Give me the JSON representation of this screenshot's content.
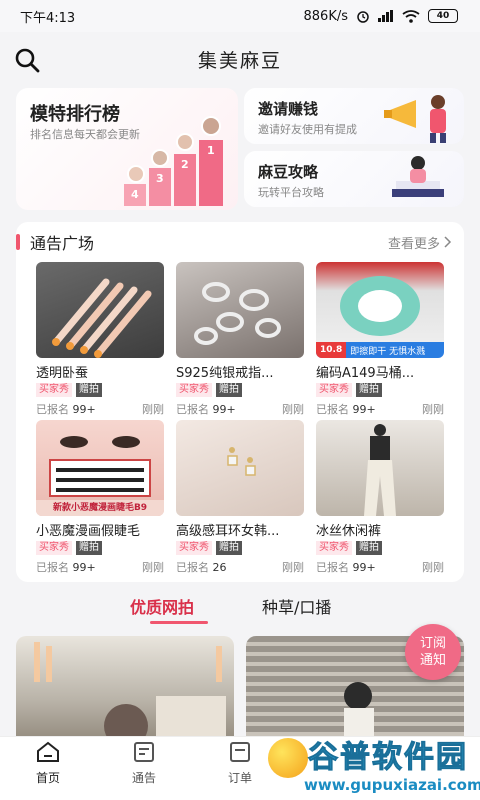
{
  "status": {
    "time": "下午4:13",
    "net_speed": "886K/s",
    "battery": "40"
  },
  "header": {
    "title": "集美麻豆"
  },
  "promo": {
    "ranking": {
      "title": "模特排行榜",
      "subtitle": "排名信息每天都会更新",
      "ranks": [
        "1",
        "2",
        "3",
        "4"
      ]
    },
    "invite": {
      "title": "邀请赚钱",
      "subtitle": "邀请好友使用有提成"
    },
    "guide": {
      "title": "麻豆攻略",
      "subtitle": "玩转平台攻略"
    }
  },
  "notice": {
    "title": "通告广场",
    "more_label": "查看更多",
    "items": [
      {
        "name": "透明卧蚕",
        "tag1": "买家秀",
        "tag2": "赠拍",
        "signed_label": "已报名",
        "count": "99+",
        "time": "刚刚"
      },
      {
        "name": "S925纯银戒指...",
        "tag1": "买家秀",
        "tag2": "赠拍",
        "signed_label": "已报名",
        "count": "99+",
        "time": "刚刚"
      },
      {
        "name": "编码A149马桶...",
        "tag1": "买家秀",
        "tag2": "赠拍",
        "signed_label": "已报名",
        "count": "99+",
        "time": "刚刚",
        "banner": "10.8",
        "banner_text": "即擦即干 无惧水溅"
      },
      {
        "name": "小恶魔漫画假睫毛",
        "tag1": "买家秀",
        "tag2": "赠拍",
        "signed_label": "已报名",
        "count": "99+",
        "time": "刚刚",
        "banner_text": "新款小恶魔漫画睫毛B9"
      },
      {
        "name": "高级感耳环女韩...",
        "tag1": "买家秀",
        "tag2": "赠拍",
        "signed_label": "已报名",
        "count": "26",
        "time": "刚刚"
      },
      {
        "name": "冰丝休闲裤",
        "tag1": "买家秀",
        "tag2": "赠拍",
        "signed_label": "已报名",
        "count": "99+",
        "time": "刚刚"
      }
    ]
  },
  "tabs": [
    {
      "label": "优质网拍"
    },
    {
      "label": "种草/口播"
    }
  ],
  "subscribe": {
    "line1": "订阅",
    "line2": "通知"
  },
  "nav": [
    {
      "label": "首页"
    },
    {
      "label": "通告"
    },
    {
      "label": "订单"
    }
  ],
  "watermark": {
    "text": "谷普软件园",
    "url": "www.gupuxiazai.com"
  },
  "colors": {
    "accent": "#f0566e",
    "tab_active": "#d9304a",
    "badge": "#f06a86"
  }
}
